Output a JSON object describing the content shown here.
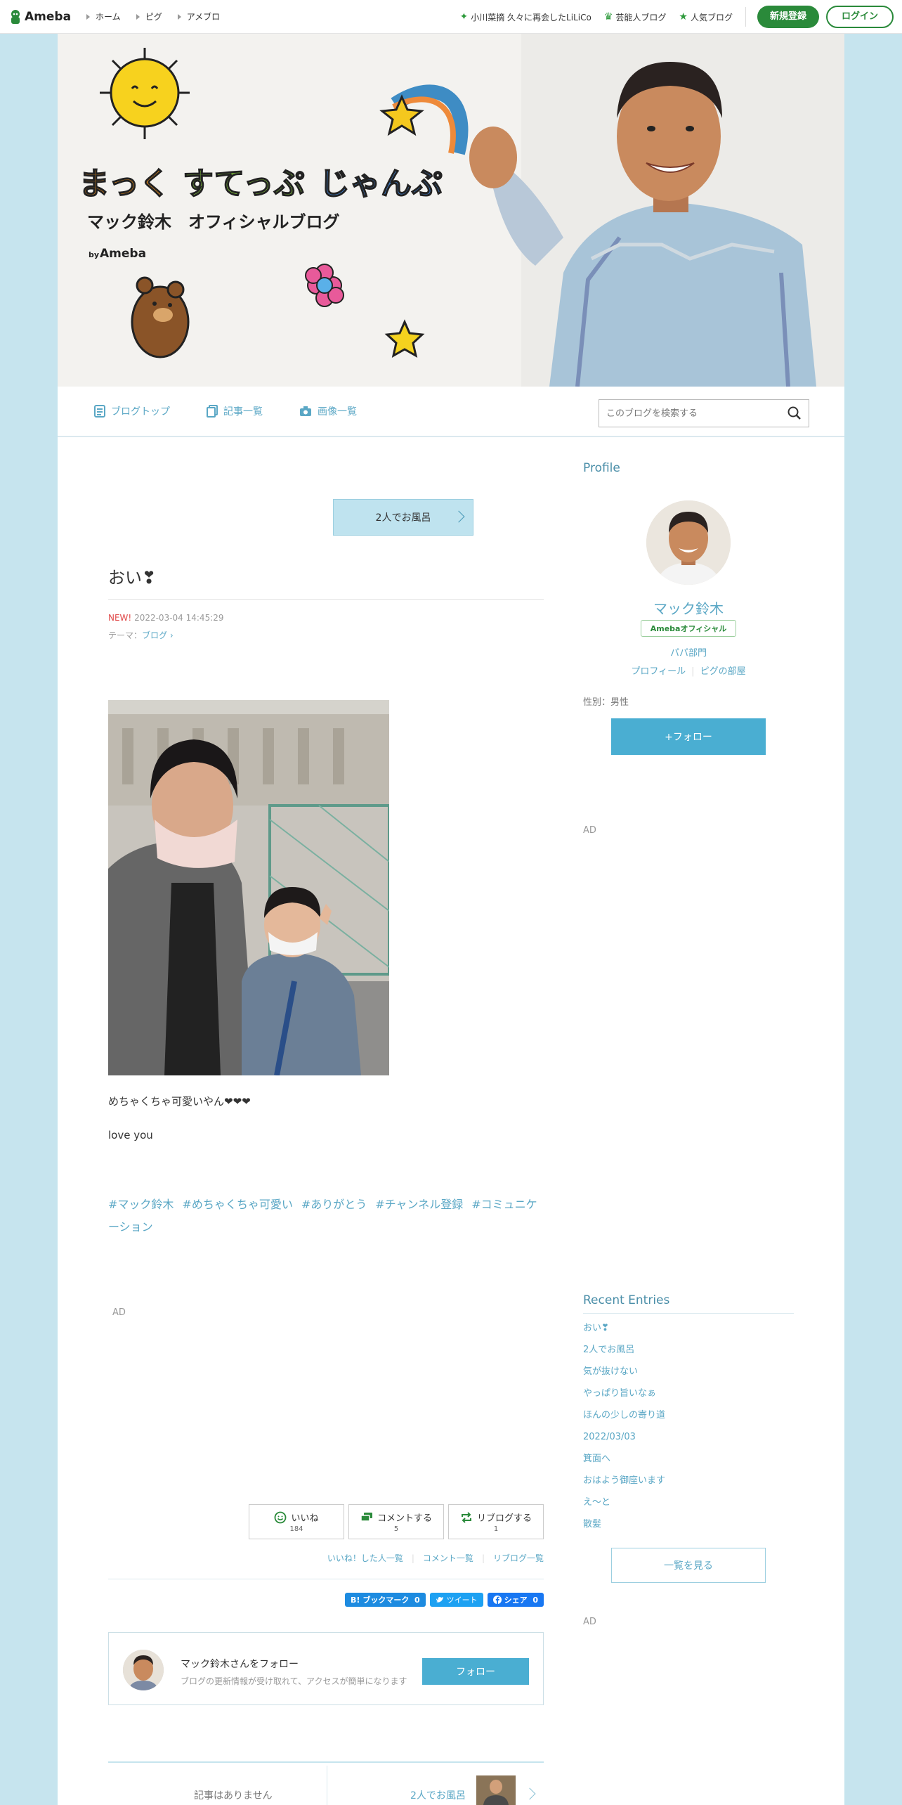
{
  "topbar": {
    "logo": "Ameba",
    "nav": [
      "ホーム",
      "ピグ",
      "アメブロ"
    ],
    "right": [
      {
        "icon": "sparkle-icon",
        "label": "小川菜摘 久々に再会したLiLiCo"
      },
      {
        "icon": "crown-icon",
        "label": "芸能人ブログ"
      },
      {
        "icon": "star-icon",
        "label": "人気ブログ"
      }
    ],
    "register": "新規登録",
    "login": "ログイン"
  },
  "header": {
    "title_line1_a": "まっく",
    "title_line1_b": "すてっぷ",
    "title_line1_c": "じゃんぷ",
    "title_line2": "マック鈴木　オフィシャルブログ",
    "by_small": "by",
    "by_brand": "Ameba"
  },
  "blognav": {
    "items": [
      "ブログトップ",
      "記事一覧",
      "画像一覧"
    ],
    "search_placeholder": "このブログを検索する"
  },
  "article": {
    "next_top": "2人でお風呂",
    "title": "おい❣",
    "new_label": "NEW!",
    "datetime": "2022-03-04 14:45:29",
    "theme_label": "テーマ：",
    "theme_value": "ブログ",
    "body_line1": "めちゃくちゃ可愛いやん❤❤❤",
    "body_line2": "love you",
    "tags": [
      "#マック鈴木",
      "#めちゃくちゃ可愛い",
      "#ありがとう",
      "#チャンネル登録",
      "#コミュニケーション"
    ],
    "ad": "AD",
    "actions": [
      {
        "label": "いいね",
        "count": "184"
      },
      {
        "label": "コメントする",
        "count": "5"
      },
      {
        "label": "リブログする",
        "count": "1"
      }
    ],
    "sublinks": [
      "いいね！した人一覧",
      "コメント一覧",
      "リブログ一覧"
    ],
    "share": {
      "hatena": "ブックマーク",
      "hatena_count": "0",
      "tweet": "ツイート",
      "fb": "シェア",
      "fb_count": "0"
    },
    "follow_title": "マック鈴木さんをフォロー",
    "follow_desc": "ブログの更新情報が受け取れて、アクセスが簡単になります",
    "follow_button": "フォロー",
    "prev_none": "記事はありません",
    "next_bottom": "2人でお風呂"
  },
  "sidebar": {
    "profile_heading": "Profile",
    "name": "マック鈴木",
    "badge": "Amebaオフィシャル",
    "category": "パパ部門",
    "link_profile": "プロフィール",
    "link_pig": "ピグの部屋",
    "gender": "性別：男性",
    "follow": "+フォロー",
    "ad": "AD",
    "recent_heading": "Recent Entries",
    "recent": [
      "おい❣",
      "2人でお風呂",
      "気が抜けない",
      "やっぱり旨いなぁ",
      "ほんの少しの寄り道",
      "2022/03/03",
      "箕面へ",
      "おはよう御座います",
      "え〜と",
      "散髪"
    ],
    "view_all": "一覧を見る",
    "ad2": "AD"
  },
  "colors": {
    "brand_green": "#2a8a3a",
    "link_blue": "#5aa7c5",
    "bg": "#c6e4ee",
    "accent": "#4aaed2"
  }
}
